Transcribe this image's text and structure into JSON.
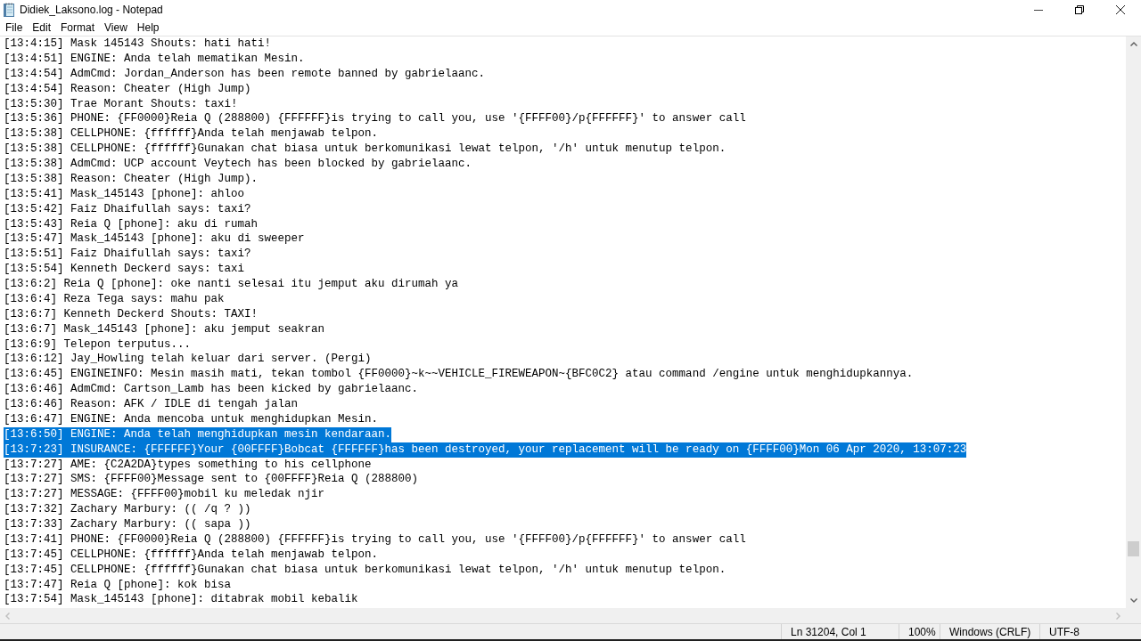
{
  "window": {
    "title": "Didiek_Laksono.log - Notepad"
  },
  "menu_bar": [
    "File",
    "Edit",
    "Format",
    "View",
    "Help"
  ],
  "editor": {
    "lines": [
      {
        "text": "[13:4:15] Mask 145143 Shouts: hati hati!",
        "selected": false
      },
      {
        "text": "[13:4:51] ENGINE: Anda telah mematikan Mesin.",
        "selected": false
      },
      {
        "text": "[13:4:54] AdmCmd: Jordan_Anderson has been remote banned by gabrielaanc.",
        "selected": false
      },
      {
        "text": "[13:4:54] Reason: Cheater (High Jump)",
        "selected": false
      },
      {
        "text": "[13:5:30] Trae Morant Shouts: taxi!",
        "selected": false
      },
      {
        "text": "[13:5:36] PHONE: {FF0000}Reia Q (288800) {FFFFFF}is trying to call you, use '{FFFF00}/p{FFFFFF}' to answer call",
        "selected": false
      },
      {
        "text": "[13:5:38] CELLPHONE: {ffffff}Anda telah menjawab telpon.",
        "selected": false
      },
      {
        "text": "[13:5:38] CELLPHONE: {ffffff}Gunakan chat biasa untuk berkomunikasi lewat telpon, '/h' untuk menutup telpon.",
        "selected": false
      },
      {
        "text": "[13:5:38] AdmCmd: UCP account Veytech has been blocked by gabrielaanc.",
        "selected": false
      },
      {
        "text": "[13:5:38] Reason: Cheater (High Jump).",
        "selected": false
      },
      {
        "text": "[13:5:41] Mask_145143 [phone]: ahloo",
        "selected": false
      },
      {
        "text": "[13:5:42] Faiz Dhaifullah says: taxi?",
        "selected": false
      },
      {
        "text": "[13:5:43] Reia Q [phone]: aku di rumah",
        "selected": false
      },
      {
        "text": "[13:5:47] Mask_145143 [phone]: aku di sweeper",
        "selected": false
      },
      {
        "text": "[13:5:51] Faiz Dhaifullah says: taxi?",
        "selected": false
      },
      {
        "text": "[13:5:54] Kenneth Deckerd says: taxi",
        "selected": false
      },
      {
        "text": "[13:6:2] Reia Q [phone]: oke nanti selesai itu jemput aku dirumah ya",
        "selected": false
      },
      {
        "text": "[13:6:4] Reza Tega says: mahu pak",
        "selected": false
      },
      {
        "text": "[13:6:7] Kenneth Deckerd Shouts: TAXI!",
        "selected": false
      },
      {
        "text": "[13:6:7] Mask_145143 [phone]: aku jemput seakran",
        "selected": false
      },
      {
        "text": "[13:6:9] Telepon terputus...",
        "selected": false
      },
      {
        "text": "[13:6:12] Jay_Howling telah keluar dari server. (Pergi)",
        "selected": false
      },
      {
        "text": "[13:6:45] ENGINEINFO: Mesin masih mati, tekan tombol {FF0000}~k~~VEHICLE_FIREWEAPON~{BFC0C2} atau command /engine untuk menghidupkannya.",
        "selected": false
      },
      {
        "text": "[13:6:46] AdmCmd: Cartson_Lamb has been kicked by gabrielaanc.",
        "selected": false
      },
      {
        "text": "[13:6:46] Reason: AFK / IDLE di tengah jalan",
        "selected": false
      },
      {
        "text": "[13:6:47] ENGINE: Anda mencoba untuk menghidupkan Mesin.",
        "selected": false
      },
      {
        "text": "[13:6:50] ENGINE: Anda telah menghidupkan mesin kendaraan.",
        "selected": true
      },
      {
        "text": "[13:7:23] INSURANCE: {FFFFFF}Your {00FFFF}Bobcat {FFFFFF}has been destroyed, your replacement will be ready on {FFFF00}Mon 06 Apr 2020, 13:07:23",
        "selected": true
      },
      {
        "text": "[13:7:27] AME: {C2A2DA}types something to his cellphone",
        "selected": false
      },
      {
        "text": "[13:7:27] SMS: {FFFF00}Message sent to {00FFFF}Reia Q (288800)",
        "selected": false
      },
      {
        "text": "[13:7:27] MESSAGE: {FFFF00}mobil ku meledak njir",
        "selected": false
      },
      {
        "text": "[13:7:32] Zachary Marbury: (( /q ? ))",
        "selected": false
      },
      {
        "text": "[13:7:33] Zachary Marbury: (( sapa ))",
        "selected": false
      },
      {
        "text": "[13:7:41] PHONE: {FF0000}Reia Q (288800) {FFFFFF}is trying to call you, use '{FFFF00}/p{FFFFFF}' to answer call",
        "selected": false
      },
      {
        "text": "[13:7:45] CELLPHONE: {ffffff}Anda telah menjawab telpon.",
        "selected": false
      },
      {
        "text": "[13:7:45] CELLPHONE: {ffffff}Gunakan chat biasa untuk berkomunikasi lewat telpon, '/h' untuk menutup telpon.",
        "selected": false
      },
      {
        "text": "[13:7:47] Reia Q [phone]: kok bisa",
        "selected": false
      },
      {
        "text": "[13:7:54] Mask_145143 [phone]: ditabrak mobil kebalik",
        "selected": false
      }
    ]
  },
  "status_bar": {
    "cursor_position": "Ln 31204, Col 1",
    "zoom": "100%",
    "line_ending": "Windows (CRLF)",
    "encoding": "UTF-8"
  }
}
